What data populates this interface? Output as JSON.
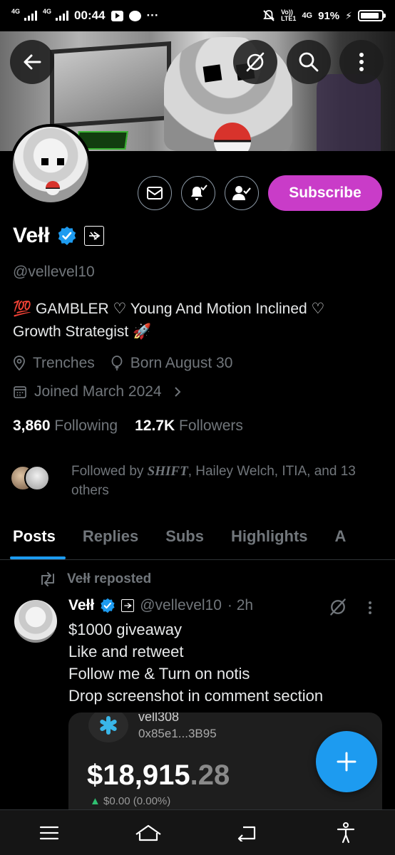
{
  "status_bar": {
    "time": "00:44",
    "signal_left_1": "4G",
    "signal_left_2": "4G",
    "network_vo": "Vo))",
    "network_lte": "LTE1",
    "network_right": "4G",
    "battery_pct": "91%",
    "battery_level": 0.91
  },
  "header": {
    "back_icon": "arrow-left-icon",
    "grok_icon": "grok-icon",
    "search_icon": "search-icon",
    "more_icon": "more-vertical-icon"
  },
  "profile": {
    "name": "Vełł",
    "handle": "@vellevel10",
    "bio_line1": "💯 GAMBLER ♡ Young And Motion Inclined ♡",
    "bio_line2": "Growth Strategist 🚀",
    "location": "Trenches",
    "birthday": "Born August 30",
    "joined": "Joined March 2024",
    "following_count": "3,860",
    "following_label": "Following",
    "followers_count": "12.7K",
    "followers_label": "Followers",
    "followed_by_prefix": "Followed by ",
    "followed_by_shift": "SHIFT",
    "followed_by_rest": ", Hailey Welch, ITIA, and 13 others",
    "subscribe_label": "Subscribe",
    "verified_color": "#1d9bf0",
    "subscribe_color": "#c93cc8"
  },
  "tabs": [
    {
      "label": "Posts",
      "active": true
    },
    {
      "label": "Replies",
      "active": false
    },
    {
      "label": "Subs",
      "active": false
    },
    {
      "label": "Highlights",
      "active": false
    },
    {
      "label": "A",
      "active": false
    }
  ],
  "post": {
    "reposted_label": "Vełł reposted",
    "author_name": "Vełł",
    "author_handle": "@vellevel10",
    "time": "· 2h",
    "lines": [
      "$1000 giveaway",
      "Like and retweet",
      "Follow me & Turn on notis",
      "Drop screenshot in comment section"
    ],
    "media": {
      "wallet_name": "vell308",
      "address": "0x85e1...3B95",
      "balance_main": "$18,915",
      "balance_cents": ".28",
      "change": "$0.00 (0.00%)"
    }
  },
  "fab": {
    "icon": "plus-icon"
  },
  "nav": {
    "menu_icon": "menu-icon",
    "home_icon": "home-icon",
    "back_icon": "back-icon",
    "accessibility_icon": "accessibility-icon"
  }
}
